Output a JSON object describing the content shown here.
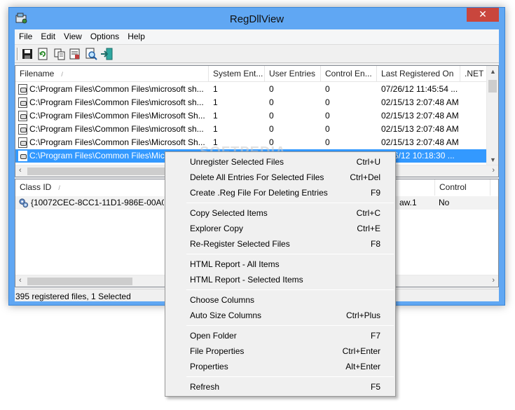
{
  "window": {
    "title": "RegDllView",
    "close_glyph": "✕"
  },
  "menu": [
    "File",
    "Edit",
    "View",
    "Options",
    "Help"
  ],
  "toolbar": {
    "buttons": [
      "save-icon",
      "refresh-icon",
      "copy-icon",
      "properties-icon",
      "find-icon",
      "exit-icon"
    ]
  },
  "top_table": {
    "columns": [
      "Filename",
      "System Ent...",
      "User Entries",
      "Control En...",
      "Last Registered On",
      ".NET"
    ],
    "rows": [
      [
        "C:\\Program Files\\Common Files\\microsoft sh...",
        "1",
        "0",
        "0",
        "07/26/12 11:45:54 ..."
      ],
      [
        "C:\\Program Files\\Common Files\\microsoft sh...",
        "1",
        "0",
        "0",
        "02/15/13 2:07:48 AM"
      ],
      [
        "C:\\Program Files\\Common Files\\Microsoft Sh...",
        "1",
        "0",
        "0",
        "02/15/13 2:07:48 AM"
      ],
      [
        "C:\\Program Files\\Common Files\\microsoft sh...",
        "1",
        "0",
        "0",
        "02/15/13 2:07:48 AM"
      ],
      [
        "C:\\Program Files\\Common Files\\Microsoft Sh...",
        "1",
        "0",
        "0",
        "02/15/13 2:07:48 AM"
      ],
      [
        "C:\\Program Files\\Common Files\\Mic",
        "",
        "",
        "",
        "6/12 10:18:30 ..."
      ]
    ],
    "selected_index": 5
  },
  "bottom_table": {
    "columns": [
      "Class ID",
      "Control"
    ],
    "rows": [
      [
        "{10072CEC-8CC1-11D1-986E-00A0C9",
        "aw.1",
        "No"
      ]
    ]
  },
  "status": "395 registered files, 1 Selected",
  "context_menu": {
    "groups": [
      [
        {
          "label": "Unregister Selected Files",
          "key": "Ctrl+U"
        },
        {
          "label": "Delete All Entries For Selected Files",
          "key": "Ctrl+Del"
        },
        {
          "label": "Create .Reg File For Deleting Entries",
          "key": "F9"
        }
      ],
      [
        {
          "label": "Copy Selected Items",
          "key": "Ctrl+C"
        },
        {
          "label": "Explorer Copy",
          "key": "Ctrl+E"
        },
        {
          "label": "Re-Register Selected Files",
          "key": "F8"
        }
      ],
      [
        {
          "label": "HTML Report - All Items",
          "key": ""
        },
        {
          "label": "HTML Report - Selected Items",
          "key": ""
        }
      ],
      [
        {
          "label": "Choose Columns",
          "key": ""
        },
        {
          "label": "Auto Size Columns",
          "key": "Ctrl+Plus"
        }
      ],
      [
        {
          "label": "Open Folder",
          "key": "F7"
        },
        {
          "label": "File Properties",
          "key": "Ctrl+Enter"
        },
        {
          "label": "Properties",
          "key": "Alt+Enter"
        }
      ],
      [
        {
          "label": "Refresh",
          "key": "F5"
        }
      ]
    ]
  },
  "watermark": "SOFTPEDIA",
  "colors": {
    "titlebar": "#60a7f3",
    "selection": "#3399ff",
    "close": "#c9463d"
  }
}
